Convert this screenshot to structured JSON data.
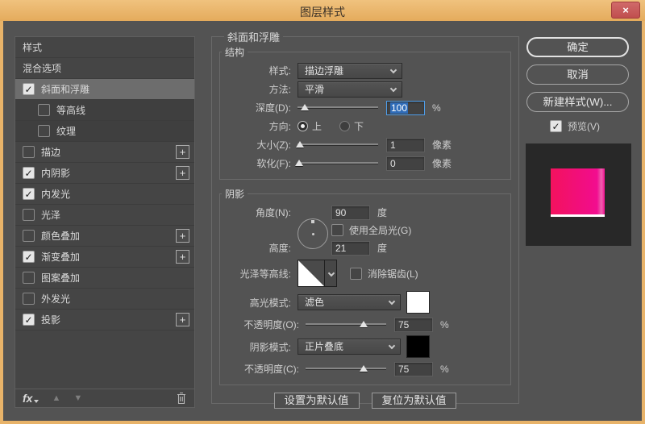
{
  "window": {
    "title": "图层样式"
  },
  "icons": {
    "check": "✓",
    "plus": "+",
    "close": "×",
    "arrow_up": "▲",
    "arrow_down": "▼",
    "fx": "fx"
  },
  "sidebar": {
    "items": [
      {
        "label": "样式",
        "checkbox": false,
        "checked": false,
        "selected": false,
        "indent": false,
        "plus": false
      },
      {
        "label": "混合选项",
        "checkbox": false,
        "checked": false,
        "selected": false,
        "indent": false,
        "plus": false
      },
      {
        "label": "斜面和浮雕",
        "checkbox": true,
        "checked": true,
        "selected": true,
        "indent": false,
        "plus": false
      },
      {
        "label": "等高线",
        "checkbox": true,
        "checked": false,
        "selected": false,
        "indent": true,
        "plus": false
      },
      {
        "label": "纹理",
        "checkbox": true,
        "checked": false,
        "selected": false,
        "indent": true,
        "plus": false
      },
      {
        "label": "描边",
        "checkbox": true,
        "checked": false,
        "selected": false,
        "indent": false,
        "plus": true
      },
      {
        "label": "内阴影",
        "checkbox": true,
        "checked": true,
        "selected": false,
        "indent": false,
        "plus": true
      },
      {
        "label": "内发光",
        "checkbox": true,
        "checked": true,
        "selected": false,
        "indent": false,
        "plus": false
      },
      {
        "label": "光泽",
        "checkbox": true,
        "checked": false,
        "selected": false,
        "indent": false,
        "plus": false
      },
      {
        "label": "颜色叠加",
        "checkbox": true,
        "checked": false,
        "selected": false,
        "indent": false,
        "plus": true
      },
      {
        "label": "渐变叠加",
        "checkbox": true,
        "checked": true,
        "selected": false,
        "indent": false,
        "plus": true
      },
      {
        "label": "图案叠加",
        "checkbox": true,
        "checked": false,
        "selected": false,
        "indent": false,
        "plus": false
      },
      {
        "label": "外发光",
        "checkbox": true,
        "checked": false,
        "selected": false,
        "indent": false,
        "plus": false
      },
      {
        "label": "投影",
        "checkbox": true,
        "checked": true,
        "selected": false,
        "indent": false,
        "plus": true
      }
    ]
  },
  "main": {
    "title": "斜面和浮雕",
    "structure": {
      "legend": "结构",
      "style_label": "样式:",
      "style_value": "描边浮雕",
      "technique_label": "方法:",
      "technique_value": "平滑",
      "depth_label": "深度(D):",
      "depth_value": "100",
      "depth_unit": "%",
      "direction_label": "方向:",
      "direction_up": "上",
      "direction_down": "下",
      "size_label": "大小(Z):",
      "size_value": "1",
      "size_unit": "像素",
      "soften_label": "软化(F):",
      "soften_value": "0",
      "soften_unit": "像素"
    },
    "shading": {
      "legend": "阴影",
      "angle_label": "角度(N):",
      "angle_value": "90",
      "angle_unit": "度",
      "global_light_label": "使用全局光(G)",
      "altitude_label": "高度:",
      "altitude_value": "21",
      "altitude_unit": "度",
      "gloss_contour_label": "光泽等高线:",
      "antialias_label": "消除锯齿(L)",
      "highlight_mode_label": "高光模式:",
      "highlight_mode_value": "滤色",
      "highlight_opacity_label": "不透明度(O):",
      "highlight_opacity_value": "75",
      "highlight_opacity_unit": "%",
      "shadow_mode_label": "阴影模式:",
      "shadow_mode_value": "正片叠底",
      "shadow_opacity_label": "不透明度(C):",
      "shadow_opacity_value": "75",
      "shadow_opacity_unit": "%"
    },
    "footer_buttons": {
      "make_default": "设置为默认值",
      "reset_default": "复位为默认值"
    }
  },
  "actions": {
    "ok": "确定",
    "cancel": "取消",
    "new_style": "新建样式(W)...",
    "preview": "预览(V)"
  },
  "colors": {
    "frame_orange": "#e8b369",
    "close_red": "#c85c5c",
    "dialog_gray": "#535353",
    "selection_blue": "#2f6cb8",
    "focus_blue": "#4f9eea",
    "swatch_pink_left": "#f3125e",
    "swatch_magenta_right": "#f20d90",
    "highlight_swatch": "#ffffff",
    "shadow_swatch": "#000000"
  }
}
